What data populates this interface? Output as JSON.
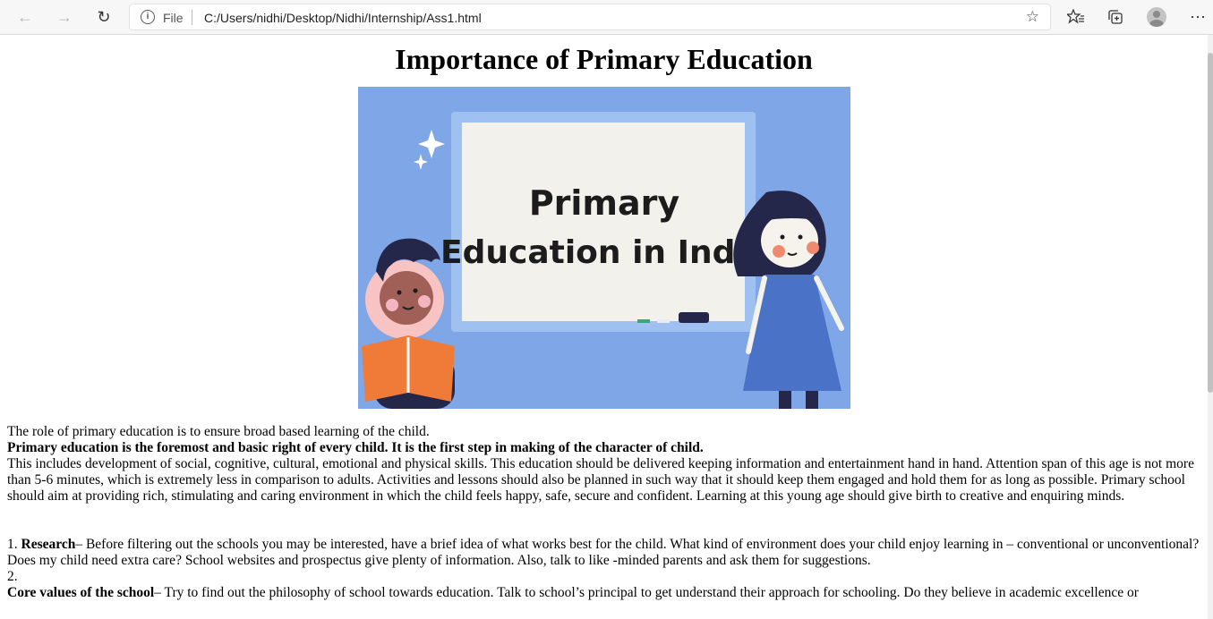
{
  "browser": {
    "address_label": "File",
    "url": "C:/Users/nidhi/Desktop/Nidhi/Internship/Ass1.html"
  },
  "page": {
    "title": "Importance of Primary Education",
    "image": {
      "board_line1": "Primary",
      "board_line2": "Education in India"
    },
    "intro": "The role of primary education is to ensure broad based learning of the child.",
    "bold_statement": "Primary education is the foremost and basic right of every child. It is the first step in making of the character of child.",
    "paragraph": "This includes development of social, cognitive, cultural, emotional and physical skills. This education should be delivered keeping information and entertainment hand in hand. Attention span of this age is not more than 5-6 minutes, which is extremely less in comparison to adults. Activities and lessons should also be planned in such way that it should keep them engaged and hold them for as long as possible. Primary school should aim at providing rich, stimulating and caring environment in which the child feels happy, safe, secure and confident. Learning at this young age should give birth to creative and enquiring minds.",
    "list": [
      {
        "number": "1.",
        "term": "Research",
        "dash": "–",
        "text": " Before filtering out the schools you may be interested, have a brief idea of what works best for the child. What kind of environment does your child enjoy learning in – conventional or unconventional? Does my child need extra care? School websites and prospectus give plenty of information. Also, talk to like -minded parents and ask them for suggestions."
      },
      {
        "number": "2.",
        "term": "Core values of the school",
        "dash": "–",
        "text": " Try to find out the philosophy of school towards education. Talk to school’s principal to get understand their approach for schooling. Do they believe in academic excellence or"
      }
    ]
  },
  "colors": {
    "image_background": "#7fa6e6",
    "board": "#f3f1ec",
    "book": "#f07a38"
  }
}
